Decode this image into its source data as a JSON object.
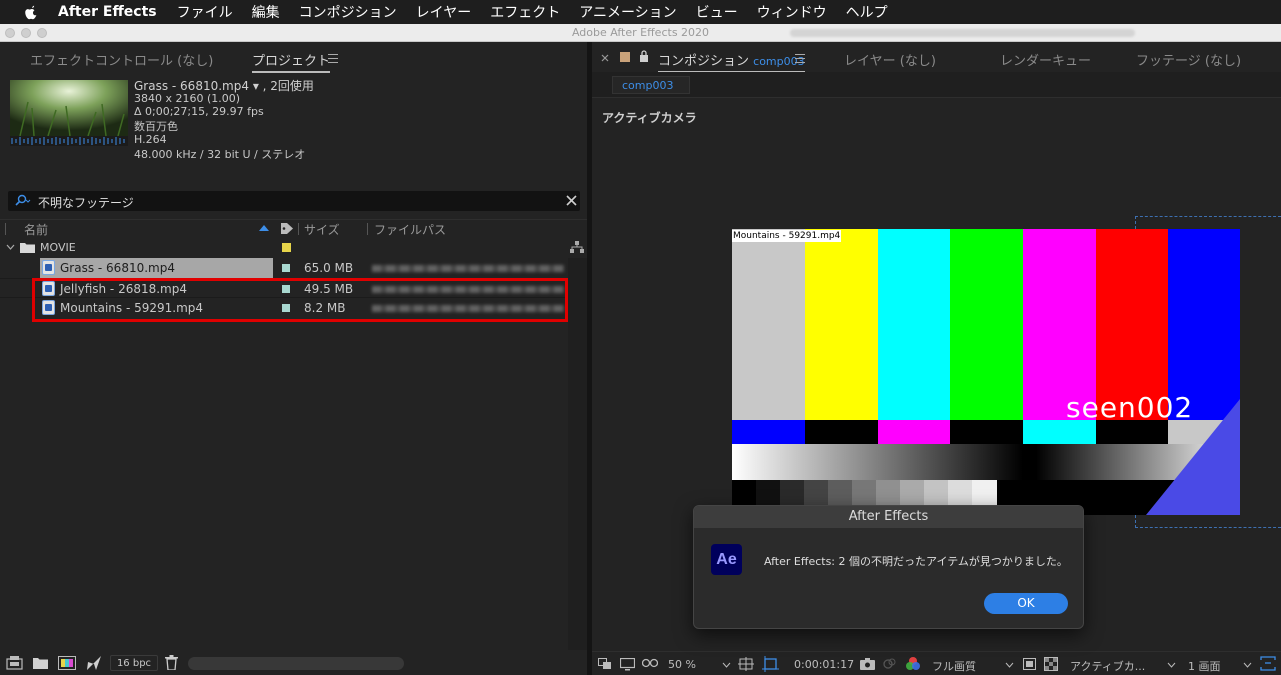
{
  "menubar": {
    "app_name": "After Effects",
    "items": [
      "ファイル",
      "編集",
      "コンポジション",
      "レイヤー",
      "エフェクト",
      "アニメーション",
      "ビュー",
      "ウィンドウ",
      "ヘルプ"
    ]
  },
  "window": {
    "title": "Adobe After Effects 2020"
  },
  "left_panel": {
    "tabs": {
      "effect_controls": "エフェクトコントロール (なし)",
      "project": "プロジェクト"
    },
    "footage_info": {
      "name": "Grass - 66810.mp4",
      "usage": "▾ , 2回使用",
      "dimensions": "3840 x 2160 (1.00)",
      "duration": "Δ 0;00;27;15, 29.97 fps",
      "colors": "数百万色",
      "codec": "H.264",
      "audio": "48.000 kHz / 32 bit U / ステレオ"
    },
    "search": {
      "value": "不明なフッテージ"
    },
    "columns": {
      "name": "名前",
      "size": "サイズ",
      "path": "ファイルパス"
    },
    "folder": {
      "name": "MOVIE"
    },
    "files": [
      {
        "name": "Grass - 66810.mp4",
        "size": "65.0 MB"
      },
      {
        "name": "Jellyfish - 26818.mp4",
        "size": "49.5 MB"
      },
      {
        "name": "Mountains - 59291.mp4",
        "size": "8.2 MB"
      }
    ],
    "footer": {
      "bpc": "16 bpc"
    }
  },
  "right_panel": {
    "tabs": {
      "composition_label": "コンポジション",
      "composition_name": "comp003",
      "layer": "レイヤー (なし)",
      "render_queue": "レンダーキュー",
      "footage": "フッテージ (なし)"
    },
    "breadcrumb": "comp003",
    "camera_label": "アクティブカメラ",
    "viewer": {
      "layer_label": "Mountains - 59291.mp4",
      "overlay_text": "seen002"
    },
    "footer": {
      "zoom": "50 %",
      "timecode": "0:00:01:17",
      "resolution": "フル画質",
      "camera": "アクティブカ...",
      "views": "1 画面"
    }
  },
  "dialog": {
    "title": "After Effects",
    "icon_text": "Ae",
    "message": "After Effects: 2 個の不明だったアイテムが見つかりました。",
    "ok_label": "OK"
  },
  "colors": {
    "accent_blue": "#2d7fe5",
    "highlight_red": "#e00000",
    "bar_colors": [
      "#c8c8c8",
      "#ffff00",
      "#00ffff",
      "#00ff00",
      "#ff00ff",
      "#ff0000",
      "#0000ff"
    ]
  }
}
